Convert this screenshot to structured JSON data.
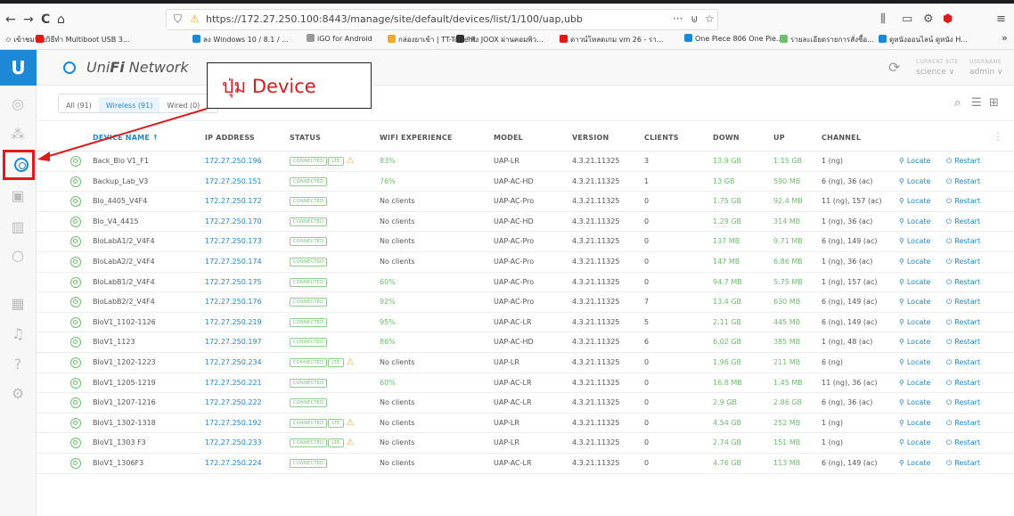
{
  "browser": {
    "back_glyph": "←",
    "forward_glyph": "→",
    "reload_glyph": "C",
    "home_glyph": "⌂",
    "url": "https://172.27.250.100:8443/manage/site/default/devices/list/1/100/uap,ubb",
    "icons": [
      "shield-icon",
      "lock-warning-icon",
      "more-icon",
      "pocket-icon",
      "star-icon",
      "library-icon",
      "reader-icon",
      "extension-icon",
      "adblock-icon",
      "menu-icon"
    ]
  },
  "bookmarks": [
    {
      "label": "✩ เข้าชมบ่อย",
      "color": "transparent"
    },
    {
      "label": "วิธีทำ Multiboot USB 3...",
      "color": "#e0191b"
    },
    {
      "label": "ลง Windows 10 / 8.1 / ...",
      "color": "#1d89d6"
    },
    {
      "label": "iGO for Android",
      "color": "#999999"
    },
    {
      "label": "กล่องยาเข้า | TT-Torrent",
      "color": "#f4a82b"
    },
    {
      "label": "\"ฟัง JOOX ผ่านคอมพิว...",
      "color": "#333333"
    },
    {
      "label": "ดาวน์โหลดเกม vm 26 - รา...",
      "color": "#e0191b"
    },
    {
      "label": "One Piece 806 One Pie...",
      "color": "#1d89d6"
    },
    {
      "label": "รายละเอียดรายการสั่งซื้อ...",
      "color": "#6bc16d"
    },
    {
      "label": "ดูหนังออนไลน์ ดูหนัง H...",
      "color": "#1d89d6"
    }
  ],
  "bookmarks_overflow": "»",
  "app": {
    "logo": "U",
    "brand_prefix": "Uni",
    "brand_bold": "Fi",
    "brand_suffix": " Network",
    "current_site_label": "CURRENT SITE",
    "current_site_value": "science ∨",
    "username_label": "USERNAME",
    "username_value": "admin ∨"
  },
  "sidebar": {
    "items": [
      "dashboard-icon",
      "topology-icon",
      "devices-icon",
      "clients-icon",
      "statistics-icon",
      "insights-icon",
      "events-icon",
      "alerts-icon",
      "help-icon",
      "settings-icon"
    ]
  },
  "filters": {
    "tabs": [
      {
        "label": "All (91)",
        "active": false
      },
      {
        "label": "Wireless (91)",
        "active": true
      },
      {
        "label": "Wired (0)",
        "active": false
      }
    ]
  },
  "callout": {
    "text": "ปุ่ม Device",
    "color": "#e0191b"
  },
  "columns": {
    "device_name": "DEVICE NAME ↑",
    "ip_address": "IP ADDRESS",
    "status": "STATUS",
    "wifi_experience": "WIFI EXPERIENCE",
    "model": "MODEL",
    "version": "VERSION",
    "clients": "CLIENTS",
    "down": "DOWN",
    "up": "UP",
    "channel": "CHANNEL"
  },
  "actions": {
    "locate": "Locate",
    "restart": "Restart"
  },
  "status_labels": {
    "connected": "CONNECTED",
    "lte": "LTE"
  },
  "devices": [
    {
      "name": "Back_Blo V1_F1",
      "ip": "172.27.250.196",
      "lte": true,
      "wifi": "83%",
      "model": "UAP-LR",
      "version": "4.3.21.11325",
      "clients": "3",
      "down": "13.9 GB",
      "up": "1.15 GB",
      "channel": "1 (ng)"
    },
    {
      "name": "Backup_Lab_V3",
      "ip": "172.27.250.151",
      "lte": false,
      "wifi": "76%",
      "model": "UAP-AC-HD",
      "version": "4.3.21.11325",
      "clients": "1",
      "down": "13 GB",
      "up": "590 MB",
      "channel": "6 (ng), 36 (ac)"
    },
    {
      "name": "Blo_4405_V4F4",
      "ip": "172.27.250.172",
      "lte": false,
      "wifi": "No clients",
      "model": "UAP-AC-Pro",
      "version": "4.3.21.11325",
      "clients": "0",
      "down": "1.75 GB",
      "up": "92.4 MB",
      "channel": "11 (ng), 157 (ac)"
    },
    {
      "name": "Blo_V4_4415",
      "ip": "172.27.250.170",
      "lte": false,
      "wifi": "No clients",
      "model": "UAP-AC-HD",
      "version": "4.3.21.11325",
      "clients": "0",
      "down": "1.29 GB",
      "up": "314 MB",
      "channel": "1 (ng), 36 (ac)"
    },
    {
      "name": "BloLabA1/2_V4F4",
      "ip": "172.27.250.173",
      "lte": false,
      "wifi": "No clients",
      "model": "UAP-AC-Pro",
      "version": "4.3.21.11325",
      "clients": "0",
      "down": "137 MB",
      "up": "9.71 MB",
      "channel": "6 (ng), 149 (ac)"
    },
    {
      "name": "BloLabA2/2_V4F4",
      "ip": "172.27.250.174",
      "lte": false,
      "wifi": "No clients",
      "model": "UAP-AC-Pro",
      "version": "4.3.21.11325",
      "clients": "0",
      "down": "147 MB",
      "up": "6.86 MB",
      "channel": "1 (ng), 36 (ac)"
    },
    {
      "name": "BloLabB1/2_V4F4",
      "ip": "172.27.250.175",
      "lte": false,
      "wifi": "60%",
      "model": "UAP-AC-Pro",
      "version": "4.3.21.11325",
      "clients": "0",
      "down": "94.7 MB",
      "up": "5.75 MB",
      "channel": "1 (ng), 157 (ac)"
    },
    {
      "name": "BloLabB2/2_V4F4",
      "ip": "172.27.250.176",
      "lte": false,
      "wifi": "92%",
      "model": "UAP-AC-Pro",
      "version": "4.3.21.11325",
      "clients": "7",
      "down": "13.4 GB",
      "up": "630 MB",
      "channel": "6 (ng), 149 (ac)"
    },
    {
      "name": "BloV1_1102-1126",
      "ip": "172.27.250.219",
      "lte": false,
      "wifi": "95%",
      "model": "UAP-AC-LR",
      "version": "4.3.21.11325",
      "clients": "5",
      "down": "2.11 GB",
      "up": "445 MB",
      "channel": "6 (ng), 149 (ac)"
    },
    {
      "name": "BloV1_1123",
      "ip": "172.27.250.197",
      "lte": false,
      "wifi": "86%",
      "model": "UAP-AC-HD",
      "version": "4.3.21.11325",
      "clients": "6",
      "down": "6.02 GB",
      "up": "385 MB",
      "channel": "1 (ng), 48 (ac)"
    },
    {
      "name": "BloV1_1202-1223",
      "ip": "172.27.250.234",
      "lte": true,
      "wifi": "No clients",
      "model": "UAP-LR",
      "version": "4.3.21.11325",
      "clients": "0",
      "down": "1.96 GB",
      "up": "211 MB",
      "channel": "6 (ng)"
    },
    {
      "name": "BloV1_1205-1219",
      "ip": "172.27.250.221",
      "lte": false,
      "wifi": "60%",
      "model": "UAP-AC-LR",
      "version": "4.3.21.11325",
      "clients": "0",
      "down": "16.8 MB",
      "up": "1.45 MB",
      "channel": "11 (ng), 36 (ac)"
    },
    {
      "name": "BloV1_1207-1216",
      "ip": "172.27.250.222",
      "lte": false,
      "wifi": "No clients",
      "model": "UAP-AC-LR",
      "version": "4.3.21.11325",
      "clients": "0",
      "down": "2.9 GB",
      "up": "2.86 GB",
      "channel": "6 (ng), 36 (ac)"
    },
    {
      "name": "BloV1_1302-1318",
      "ip": "172.27.250.192",
      "lte": true,
      "wifi": "No clients",
      "model": "UAP-LR",
      "version": "4.3.21.11325",
      "clients": "0",
      "down": "4.54 GB",
      "up": "252 MB",
      "channel": "1 (ng)"
    },
    {
      "name": "BloV1_1303 F3",
      "ip": "172.27.250.233",
      "lte": true,
      "wifi": "No clients",
      "model": "UAP-LR",
      "version": "4.3.21.11325",
      "clients": "0",
      "down": "2.74 GB",
      "up": "151 MB",
      "channel": "1 (ng)"
    },
    {
      "name": "BloV1_1306F3",
      "ip": "172.27.250.224",
      "lte": false,
      "wifi": "No clients",
      "model": "UAP-AC-LR",
      "version": "4.3.21.11325",
      "clients": "0",
      "down": "4.76 GB",
      "up": "113 MB",
      "channel": "6 (ng), 149 (ac)"
    }
  ],
  "colors": {
    "accent": "#1d89d6",
    "success": "#6bc16d",
    "warning": "#f4a82b",
    "highlight": "#e0191b"
  }
}
